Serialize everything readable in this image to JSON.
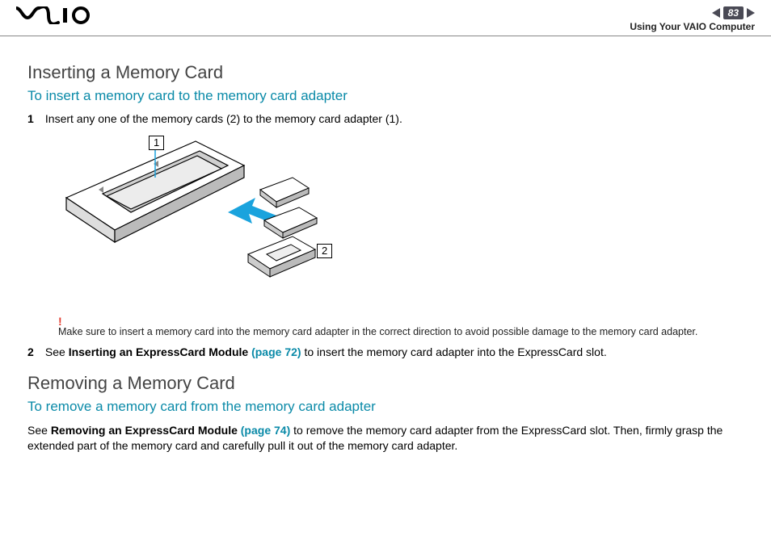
{
  "header": {
    "logo_alt": "VAIO",
    "nav": {
      "page_number": "83"
    },
    "section": "Using Your VAIO Computer"
  },
  "section1": {
    "heading": "Inserting a Memory Card",
    "subheading": "To insert a memory card to the memory card adapter",
    "step1": {
      "num": "1",
      "text": "Insert any one of the memory cards (2) to the memory card adapter (1)."
    },
    "figure": {
      "callout1": "1",
      "callout2": "2"
    },
    "warning": {
      "bang": "!",
      "text": "Make sure to insert a memory card into the memory card adapter in the correct direction to avoid possible damage to the memory card adapter."
    },
    "step2": {
      "num": "2",
      "pre": "See ",
      "bold": "Inserting an ExpressCard Module ",
      "link": "(page 72)",
      "post": " to insert the memory card adapter into the ExpressCard slot."
    }
  },
  "section2": {
    "heading": "Removing a Memory Card",
    "subheading": "To remove a memory card from the memory card adapter",
    "body": {
      "pre": "See ",
      "bold": "Removing an ExpressCard Module ",
      "link": "(page 74)",
      "post": " to remove the memory card adapter from the ExpressCard slot. Then, firmly grasp the extended part of the memory card and carefully pull it out of the memory card adapter."
    }
  }
}
